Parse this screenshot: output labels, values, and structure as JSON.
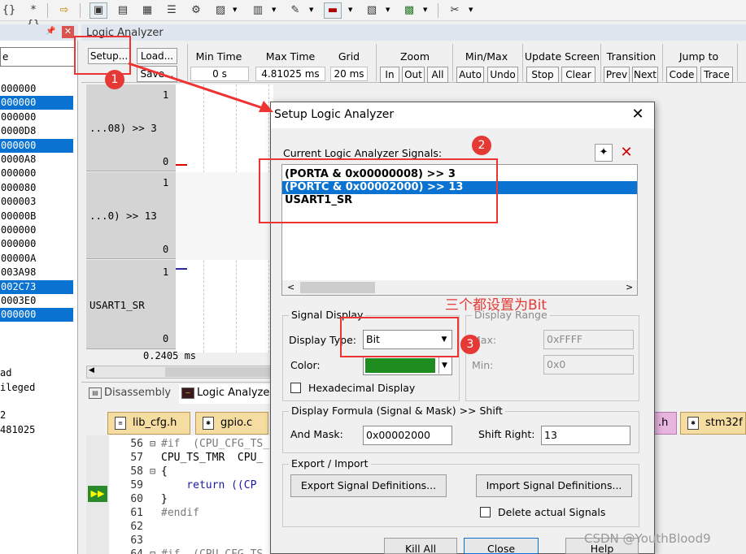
{
  "toolbar": {
    "items": [
      {
        "icon": "braces-close-icon",
        "glyph": "{}"
      },
      {
        "icon": "braces-open-icon",
        "glyph": "*{}"
      },
      {
        "icon": "arrow-icon",
        "glyph": "⇨"
      },
      {
        "icon": "command-window-icon",
        "glyph": "▣"
      },
      {
        "icon": "disassembly-window-icon",
        "glyph": "▤"
      },
      {
        "icon": "symbols-window-icon",
        "glyph": "▦"
      },
      {
        "icon": "registers-window-icon",
        "glyph": "☰"
      },
      {
        "icon": "call-stack-icon",
        "glyph": "⚙"
      },
      {
        "icon": "watch-window-icon",
        "glyph": "▨"
      },
      {
        "icon": "memory-window-icon",
        "glyph": "▥"
      },
      {
        "icon": "serial-window-icon",
        "glyph": "✎"
      },
      {
        "icon": "analysis-window-icon",
        "glyph": "▬"
      },
      {
        "icon": "trace-window-icon",
        "glyph": "▧"
      },
      {
        "icon": "system-viewer-icon",
        "glyph": "▩"
      },
      {
        "icon": "toolbox-icon",
        "glyph": "✂"
      }
    ]
  },
  "left_panel": {
    "field_value": "e",
    "rows": [
      {
        "text": "000000",
        "selected": false
      },
      {
        "text": "000000",
        "selected": true
      },
      {
        "text": "000000",
        "selected": false
      },
      {
        "text": "0000D8",
        "selected": false
      },
      {
        "text": "000000",
        "selected": true
      },
      {
        "text": "0000A8",
        "selected": false
      },
      {
        "text": "000000",
        "selected": false
      },
      {
        "text": "000080",
        "selected": false
      },
      {
        "text": "000003",
        "selected": false
      },
      {
        "text": "00000B",
        "selected": false
      },
      {
        "text": "000000",
        "selected": false
      },
      {
        "text": "000000",
        "selected": false
      },
      {
        "text": "00000A",
        "selected": false
      },
      {
        "text": "003A98",
        "selected": false
      },
      {
        "text": "002C73",
        "selected": true
      },
      {
        "text": "0003E0",
        "selected": false
      },
      {
        "text": "000000",
        "selected": true
      }
    ],
    "bottom_lines": [
      "ad",
      "ileged",
      "2",
      "481025"
    ]
  },
  "logic_analyzer": {
    "title": "Logic Analyzer",
    "setup_label": "Setup...",
    "load_label": "Load...",
    "save_label": "Save...",
    "min_time_label": "Min Time",
    "min_time_value": "0 s",
    "max_time_label": "Max Time",
    "max_time_value": "4.81025 ms",
    "grid_label": "Grid",
    "grid_value": "20 ms",
    "zoom_label": "Zoom",
    "zoom_in": "In",
    "zoom_out": "Out",
    "zoom_all": "All",
    "minmax_label": "Min/Max",
    "minmax_auto": "Auto",
    "minmax_undo": "Undo",
    "update_label": "Update Screen",
    "update_stop": "Stop",
    "update_clear": "Clear",
    "transition_label": "Transition",
    "transition_prev": "Prev",
    "transition_next": "Next",
    "jump_label": "Jump to",
    "jump_code": "Code",
    "jump_trace": "Trace",
    "signals": [
      {
        "name": "...08) >> 3",
        "top": "1",
        "bottom": "0"
      },
      {
        "name": "...0) >> 13",
        "top": "1",
        "bottom": "0"
      },
      {
        "name": "USART1_SR",
        "top": "1",
        "bottom": "0"
      }
    ],
    "time_readout": "0.2405 ms"
  },
  "bottom_tabs": {
    "disassembly": "Disassembly",
    "logic_analyzer": "Logic Analyzer"
  },
  "file_tabs": [
    "lib_cfg.h",
    "gpio.c",
    ".h",
    "stm32f"
  ],
  "editor": {
    "lines": [
      {
        "num": "56",
        "fold": "⊟",
        "code": "#if  (CPU_CFG_TS_"
      },
      {
        "num": "57",
        "fold": "",
        "code": "CPU_TS_TMR  CPU_"
      },
      {
        "num": "58",
        "fold": "⊟",
        "code": "{"
      },
      {
        "num": "59",
        "fold": "",
        "code": "    return ((CP"
      },
      {
        "num": "60",
        "fold": "",
        "code": "}"
      },
      {
        "num": "61",
        "fold": "",
        "code": "#endif"
      },
      {
        "num": "62",
        "fold": "",
        "code": ""
      },
      {
        "num": "63",
        "fold": "",
        "code": ""
      },
      {
        "num": "64",
        "fold": "⊟",
        "code": "#if  (CPU_CFG_TS"
      }
    ]
  },
  "dialog": {
    "title": "Setup Logic Analyzer",
    "signals_label": "Current Logic Analyzer Signals:",
    "signals": [
      {
        "text": "(PORTA & 0x00000008) >> 3",
        "selected": false
      },
      {
        "text": "(PORTC & 0x00002000) >> 13",
        "selected": true
      },
      {
        "text": "USART1_SR",
        "selected": false
      }
    ],
    "signal_display_title": "Signal Display",
    "display_type_label": "Display Type:",
    "display_type_value": "Bit",
    "color_label": "Color:",
    "color_value": "#1e8c1e",
    "hex_display_label": "Hexadecimal Display",
    "display_range_title": "Display Range",
    "max_label": "Max:",
    "max_value": "0xFFFF",
    "min_label": "Min:",
    "min_value": "0x0",
    "formula_title": "Display Formula (Signal & Mask) >> Shift",
    "and_mask_label": "And Mask:",
    "and_mask_value": "0x00002000",
    "shift_right_label": "Shift Right:",
    "shift_right_value": "13",
    "export_import_title": "Export / Import",
    "export_button": "Export Signal Definitions...",
    "import_button": "Import Signal Definitions...",
    "delete_label": "Delete actual Signals",
    "kill_all": "Kill All",
    "close": "Close",
    "help": "Help"
  },
  "annotations": {
    "badge1": "1",
    "badge2": "2",
    "badge3": "3",
    "note": "三个都设置为Bit",
    "accent": "#e53935"
  },
  "watermark": "CSDN @YouthBlood9"
}
